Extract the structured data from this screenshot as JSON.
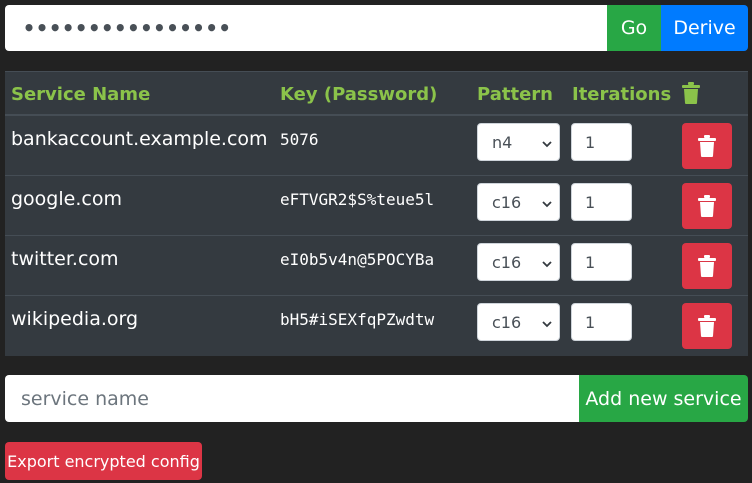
{
  "master": {
    "value": "••••••••••••••••",
    "go_label": "Go",
    "derive_label": "Derive"
  },
  "table": {
    "headers": {
      "service": "Service Name",
      "key": "Key (Password)",
      "pattern": "Pattern",
      "iterations": "Iterations"
    },
    "header_icon": "trash-icon",
    "rows": [
      {
        "service": "bankaccount.example.com",
        "key": "5076",
        "pattern": "n4",
        "iterations": "1"
      },
      {
        "service": "google.com",
        "key": "eFTVGR2$S%teue5l",
        "pattern": "c16",
        "iterations": "1"
      },
      {
        "service": "twitter.com",
        "key": "eI0b5v4n@5POCYBa",
        "pattern": "c16",
        "iterations": "1"
      },
      {
        "service": "wikipedia.org",
        "key": "bH5#iSEXfqPZwdtw",
        "pattern": "c16",
        "iterations": "1"
      }
    ]
  },
  "add_service": {
    "placeholder": "service name",
    "button_label": "Add new service"
  },
  "export": {
    "button_label": "Export encrypted config"
  },
  "colors": {
    "background": "#222222",
    "table_bg": "#343a40",
    "header_text": "#8bc34a",
    "success": "#28a745",
    "primary": "#007bff",
    "danger": "#dc3545"
  }
}
